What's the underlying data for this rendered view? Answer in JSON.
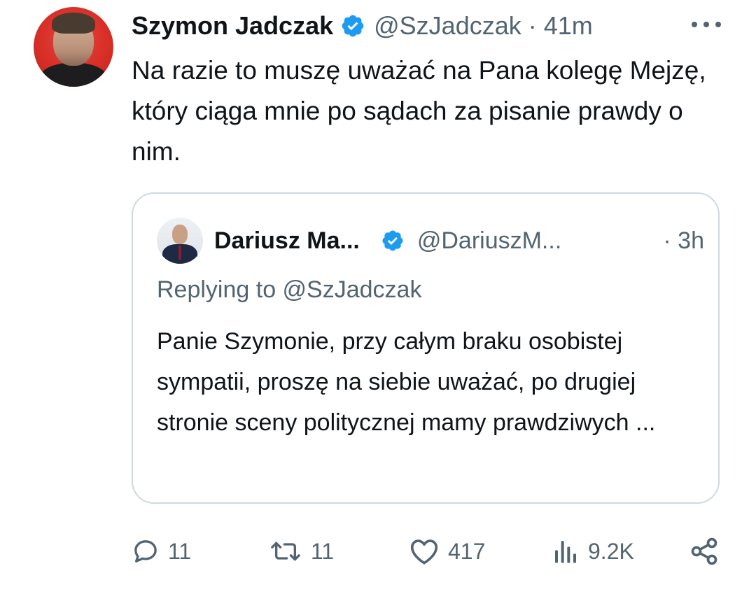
{
  "author": {
    "name": "Szymon Jadczak",
    "handle": "@SzJadczak",
    "time": "41m",
    "separator": "·",
    "verified": true
  },
  "tweet_text": "Na razie to muszę uważać na Pana kolegę Mejzę, który ciąga mnie po sądach za pisanie prawdy o nim.",
  "quoted": {
    "name": "Dariusz Ma...",
    "handle": "@DariuszM...",
    "time": "· 3h",
    "verified": true,
    "replying_to": "Replying to @SzJadczak",
    "text": "Panie Szymonie, przy całym braku osobistej sympatii, proszę na siebie uważać, po drugiej stronie sceny politycznej mamy prawdziwych ..."
  },
  "actions": {
    "replies": "11",
    "reposts": "11",
    "likes": "417",
    "views": "9.2K"
  },
  "icons": {
    "more": "more-horizontal-icon",
    "reply": "reply-bubble-icon",
    "repost": "repost-icon",
    "like": "heart-icon",
    "views": "views-bar-chart-icon",
    "share": "share-icon",
    "verified": "verified-badge-icon"
  },
  "colors": {
    "text": "#0f1419",
    "secondary": "#536471",
    "verified": "#1d9bf0",
    "border": "#cfd9de"
  }
}
